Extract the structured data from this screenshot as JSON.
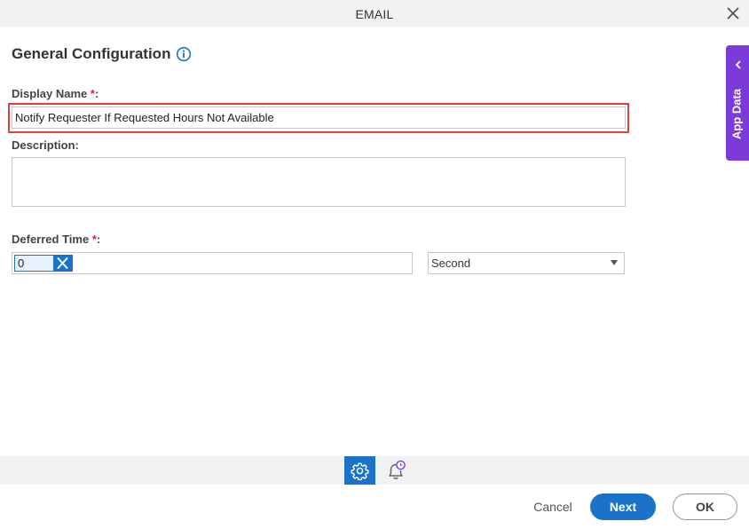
{
  "dialog": {
    "title": "EMAIL"
  },
  "section": {
    "title": "General Configuration"
  },
  "display_name": {
    "label": "Display Name",
    "required_mark": "*",
    "suffix": ":",
    "value": "Notify Requester If Requested Hours Not Available"
  },
  "description": {
    "label": "Description:",
    "value": ""
  },
  "deferred_time": {
    "label": "Deferred Time",
    "required_mark": "*",
    "suffix": ":",
    "value": "0",
    "unit": "Second"
  },
  "side_panel": {
    "label": "App Data"
  },
  "footer": {
    "cancel_label": "Cancel",
    "next_label": "Next",
    "ok_label": "OK"
  },
  "colors": {
    "accent": "#1a73c8",
    "app_data": "#7c3ad8",
    "required": "#d9232e",
    "highlight": "#e04040"
  },
  "icons": {
    "close": "close-icon",
    "info": "info-icon",
    "settings": "gear-icon",
    "notifications": "bell-clock-icon",
    "clear": "clear-x-icon",
    "panel": "chevron-left-icon"
  }
}
